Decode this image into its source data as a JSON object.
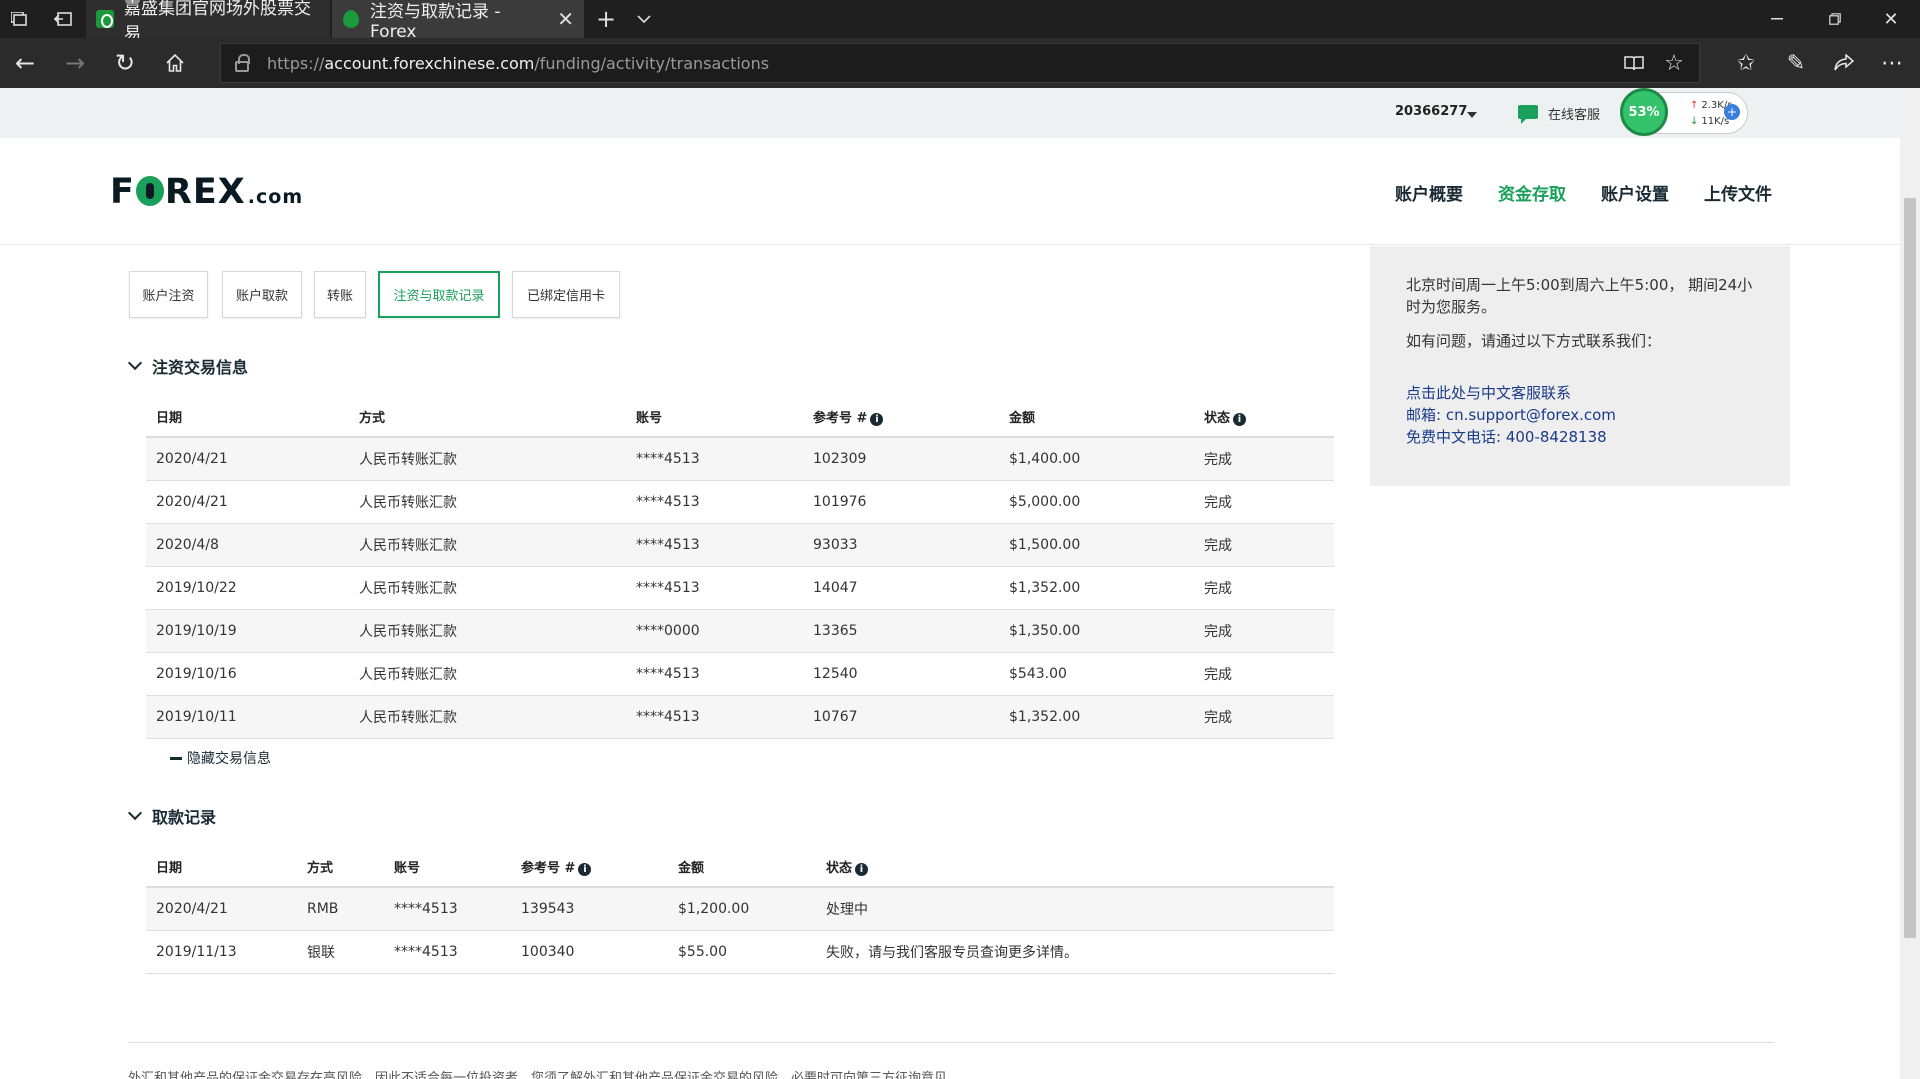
{
  "browser": {
    "tabs": [
      {
        "title": "嘉盛集团官网场外股票交易",
        "active": false
      },
      {
        "title": "注资与取款记录 - Forex",
        "active": true
      }
    ],
    "url_scheme": "https://",
    "url_host": "account.forexchinese.com",
    "url_path": "/funding/activity/transactions"
  },
  "topbar": {
    "account_number": "20366277",
    "online_service": "在线客服",
    "speed": {
      "percent": "53%",
      "up": "2.3K/s",
      "down": "11K/s",
      "plus": "+"
    }
  },
  "logo": {
    "part1": "F",
    "part2": "REX",
    "dotcom": ".com"
  },
  "nav": [
    {
      "label": "账户概要",
      "active": false
    },
    {
      "label": "资金存取",
      "active": true
    },
    {
      "label": "账户设置",
      "active": false
    },
    {
      "label": "上传文件",
      "active": false
    }
  ],
  "subtabs": [
    {
      "label": "账户注资",
      "active": false
    },
    {
      "label": "账户取款",
      "active": false
    },
    {
      "label": "转账",
      "active": false
    },
    {
      "label": "注资与取款记录",
      "active": true
    },
    {
      "label": "已绑定信用卡",
      "active": false
    }
  ],
  "deposits": {
    "title": "注资交易信息",
    "headers": [
      "日期",
      "方式",
      "账号",
      "参考号 #",
      "金额",
      "状态"
    ],
    "rows": [
      [
        "2020/4/21",
        "人民币转账汇款",
        "****4513",
        "102309",
        "$1,400.00",
        "完成"
      ],
      [
        "2020/4/21",
        "人民币转账汇款",
        "****4513",
        "101976",
        "$5,000.00",
        "完成"
      ],
      [
        "2020/4/8",
        "人民币转账汇款",
        "****4513",
        "93033",
        "$1,500.00",
        "完成"
      ],
      [
        "2019/10/22",
        "人民币转账汇款",
        "****4513",
        "14047",
        "$1,352.00",
        "完成"
      ],
      [
        "2019/10/19",
        "人民币转账汇款",
        "****0000",
        "13365",
        "$1,350.00",
        "完成"
      ],
      [
        "2019/10/16",
        "人民币转账汇款",
        "****4513",
        "12540",
        "$543.00",
        "完成"
      ],
      [
        "2019/10/11",
        "人民币转账汇款",
        "****4513",
        "10767",
        "$1,352.00",
        "完成"
      ]
    ],
    "hide_link": "隐藏交易信息"
  },
  "withdrawals": {
    "title": "取款记录",
    "headers": [
      "日期",
      "方式",
      "账号",
      "参考号 #",
      "金额",
      "状态"
    ],
    "rows": [
      [
        "2020/4/21",
        "RMB",
        "****4513",
        "139543",
        "$1,200.00",
        "处理中"
      ],
      [
        "2019/11/13",
        "银联",
        "****4513",
        "100340",
        "$55.00",
        "失败，请与我们客服专员查询更多详情。"
      ]
    ]
  },
  "sidepanel": {
    "hours": "北京时间周一上午5:00到周六上午5:00， 期间24小时为您服务。",
    "question": "如有问题，请通过以下方式联系我们：",
    "contact_link": "点击此处与中文客服联系",
    "email": "邮箱: cn.support@forex.com",
    "phone": "免费中文电话: 400-8428138"
  },
  "footer": {
    "text": "外汇和其他产品的保证金交易存在高风险，因此不适合每一位投资者，您须了解外汇和其他产品保证金交易的风险，必要时可向第三方征询意见"
  },
  "colors": {
    "brand_green": "#1aa05a",
    "dark_text": "#1a2a33"
  }
}
